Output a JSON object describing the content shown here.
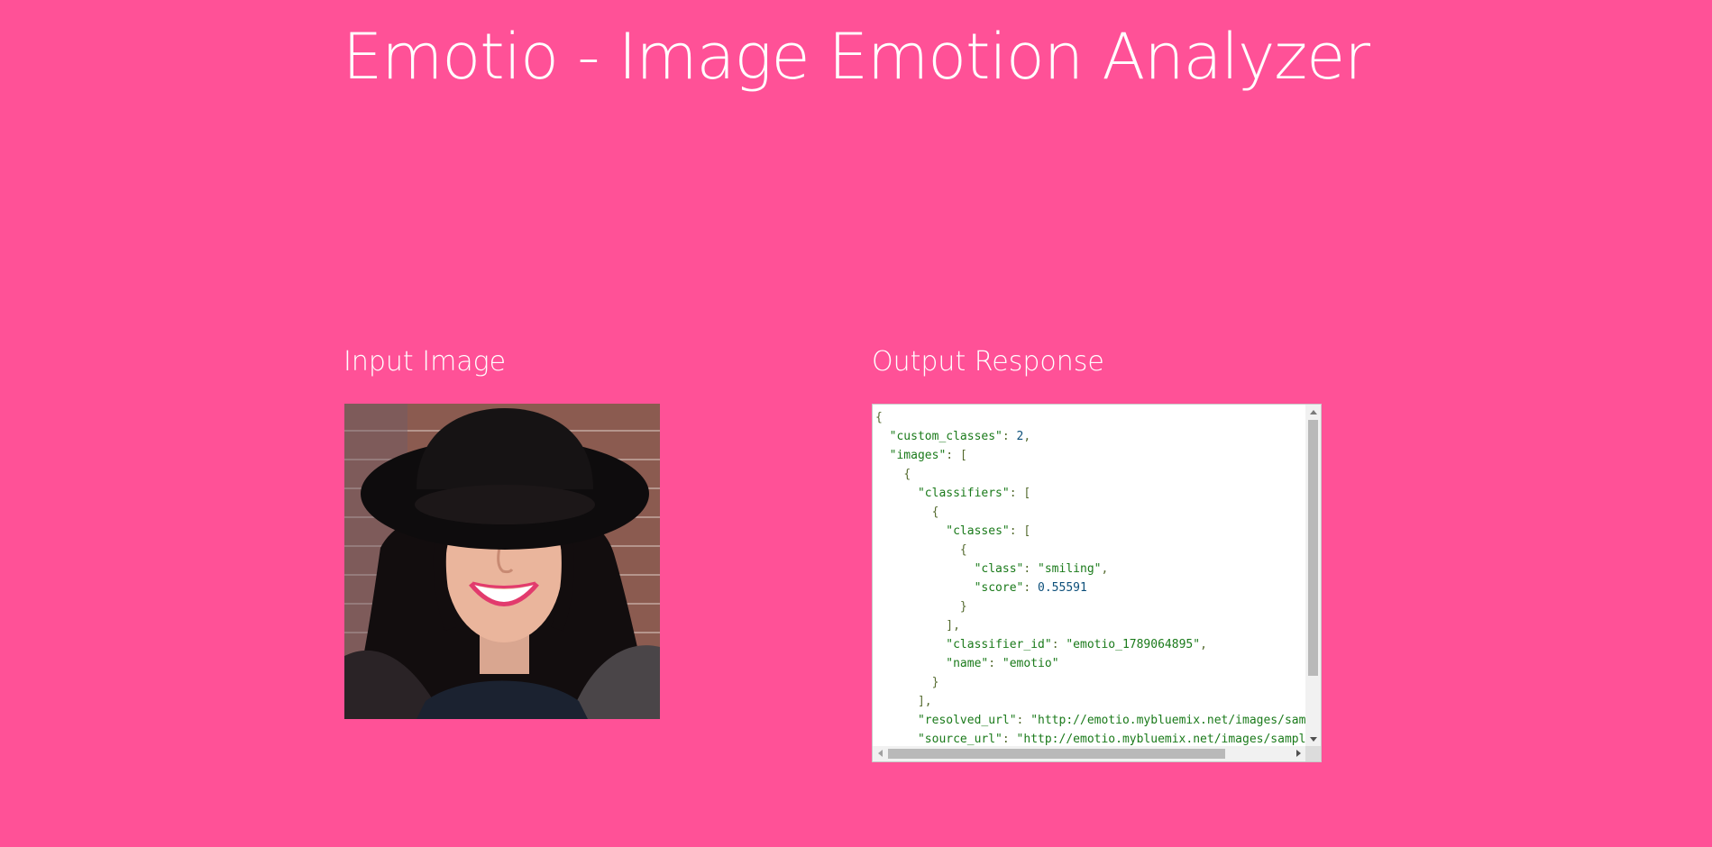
{
  "app": {
    "title": "Emotio - Image Emotion Analyzer"
  },
  "input": {
    "heading": "Input Image",
    "image_icon": "portrait-photo"
  },
  "output": {
    "heading": "Output Response",
    "lines": [
      "{",
      "  \"custom_classes\": 2,",
      "  \"images\": [",
      "    {",
      "      \"classifiers\": [",
      "        {",
      "          \"classes\": [",
      "            {",
      "              \"class\": \"smiling\",",
      "              \"score\": 0.55591",
      "            }",
      "          ],",
      "          \"classifier_id\": \"emotio_1789064895\",",
      "          \"name\": \"emotio\"",
      "        }",
      "      ],",
      "      \"resolved_url\": \"http://emotio.mybluemix.net/images/sam",
      "      \"source_url\": \"http://emotio.mybluemix.net/images/sampl"
    ]
  },
  "colors": {
    "background": "#ff5197",
    "text": "#ffffff",
    "json_key": "#1a7a1a",
    "json_number": "#0c4f7a"
  }
}
